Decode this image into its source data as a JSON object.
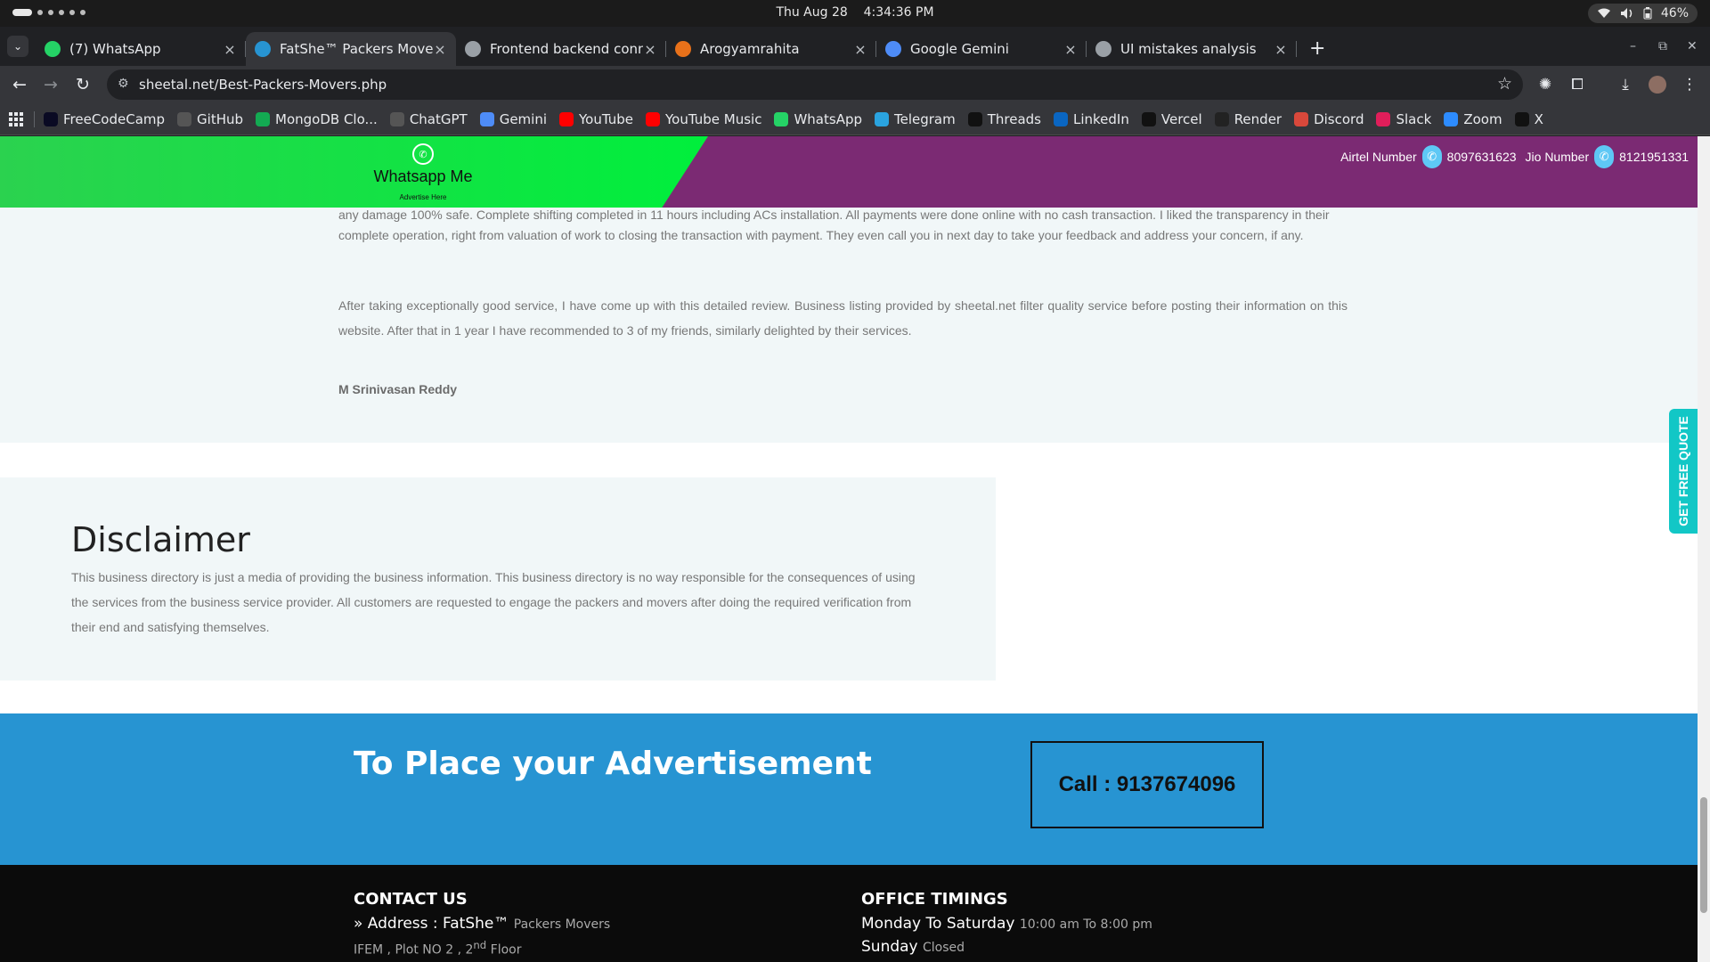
{
  "os": {
    "clock_date": "Thu Aug 28",
    "clock_time": "4:34:36 PM",
    "battery": "46%"
  },
  "tabs": [
    {
      "title": "(7) WhatsApp",
      "favicon": "whatsapp-icon",
      "color": "#25d366",
      "active": false
    },
    {
      "title": "FatShe™ Packers Movers",
      "favicon": "site-icon",
      "color": "#2794d2",
      "active": true
    },
    {
      "title": "Frontend backend conne",
      "favicon": "chatgpt-icon",
      "color": "#9aa0a6",
      "active": false
    },
    {
      "title": "Arogyamrahita",
      "favicon": "site-icon",
      "color": "#e8711a",
      "active": false
    },
    {
      "title": "Google Gemini",
      "favicon": "gemini-icon",
      "color": "#4e8cf7",
      "active": false
    },
    {
      "title": "UI mistakes analysis",
      "favicon": "chatgpt-icon",
      "color": "#9aa0a6",
      "active": false
    }
  ],
  "toolbar": {
    "url": "sheetal.net/Best-Packers-Movers.php"
  },
  "bookmarks": [
    {
      "label": "FreeCodeCamp",
      "icon": "freecodecamp-icon",
      "color": "#0a0a23"
    },
    {
      "label": "GitHub",
      "icon": "github-icon",
      "color": "#555"
    },
    {
      "label": "MongoDB Clo...",
      "icon": "mongodb-icon",
      "color": "#13aa52"
    },
    {
      "label": "ChatGPT",
      "icon": "chatgpt-icon",
      "color": "#555"
    },
    {
      "label": "Gemini",
      "icon": "gemini-icon",
      "color": "#4e8cf7"
    },
    {
      "label": "YouTube",
      "icon": "youtube-icon",
      "color": "#ff0000"
    },
    {
      "label": "YouTube Music",
      "icon": "youtube-music-icon",
      "color": "#ff0000"
    },
    {
      "label": "WhatsApp",
      "icon": "whatsapp-icon",
      "color": "#25d366"
    },
    {
      "label": "Telegram",
      "icon": "telegram-icon",
      "color": "#2aa3df"
    },
    {
      "label": "Threads",
      "icon": "threads-icon",
      "color": "#111"
    },
    {
      "label": "LinkedIn",
      "icon": "linkedin-icon",
      "color": "#0a66c2"
    },
    {
      "label": "Vercel",
      "icon": "vercel-icon",
      "color": "#111"
    },
    {
      "label": "Render",
      "icon": "render-icon",
      "color": "#222"
    },
    {
      "label": "Discord",
      "icon": "discord-icon",
      "color": "#d9483b"
    },
    {
      "label": "Slack",
      "icon": "slack-icon",
      "color": "#e01e5a"
    },
    {
      "label": "Zoom",
      "icon": "zoom-icon",
      "color": "#2d8cff"
    },
    {
      "label": "X",
      "icon": "x-icon",
      "color": "#111"
    }
  ],
  "page": {
    "whatsapp_label": "Whatsapp Me",
    "advertise_label": "Advertise Here",
    "airtel_label": "Airtel Number",
    "airtel_number": "8097631623",
    "jio_label": "Jio Number",
    "jio_number": "8121951331",
    "review_line1": "any damage 100% safe. Complete shifting completed in 11 hours including ACs installation. All payments were done online with no cash transaction. I liked the transparency in their",
    "review_line2": "complete operation, right from valuation of work to closing the transaction with payment. They even call you in next day to take your feedback and address your concern, if any.",
    "review_para2": "After taking exceptionally good service, I have come up with this detailed review. Business listing provided by sheetal.net filter quality service before posting their information on this website. After that in 1 year I have recommended to 3 of my friends, similarly delighted by their services.",
    "reviewer": "M Srinivasan Reddy",
    "disclaimer_title": "Disclaimer",
    "disclaimer_text": "This business directory is just a media of providing the business information. This business directory is no way responsible for the consequences of using the services from the business service provider. All customers are requested to engage the packers and movers after doing the required verification from their end and satisfying themselves.",
    "quote_label": "GET FREE QUOTE",
    "ad_title": "To Place your Advertisement",
    "call_label": "Call : 9137674096",
    "contact_title": "CONTACT US",
    "address_prefix": "» Address : FatShe™",
    "address_small": "Packers Movers",
    "address_line2": "IFEM , Plot NO 2 , 2",
    "address_sup": "nd",
    "address_floor": " Floor",
    "office_title": "OFFICE TIMINGS",
    "weekday_label": "Monday To Saturday",
    "weekday_hours": "10:00 am To 8:00 pm",
    "sunday_label": "Sunday",
    "sunday_hours": "Closed"
  },
  "colors": {
    "top_purple": "#7b2a73",
    "whatsapp_green": "#00ef3c",
    "ad_blue": "#2794d2",
    "quote_teal": "#12c7c6",
    "footer_black": "#0b0b0b"
  }
}
